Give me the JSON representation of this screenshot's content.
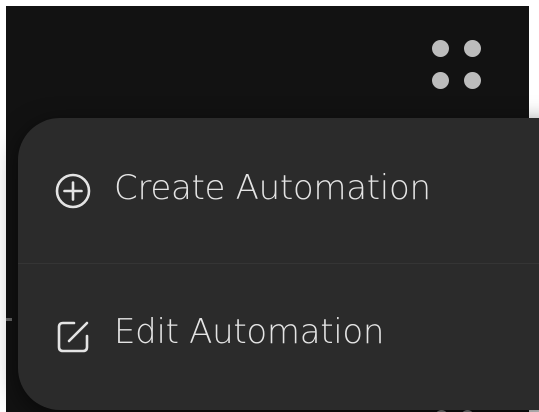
{
  "header": {
    "more_button_icon": "grid-dots-icon"
  },
  "menu": {
    "items": [
      {
        "label": "Create Automation",
        "icon": "plus-circle-icon"
      },
      {
        "label": "Edit Automation",
        "icon": "edit-square-icon"
      }
    ]
  },
  "colors": {
    "background": "#121212",
    "menu_background": "#2b2b2b",
    "text": "#e4e4e4",
    "dots": "#bcbcbc"
  }
}
